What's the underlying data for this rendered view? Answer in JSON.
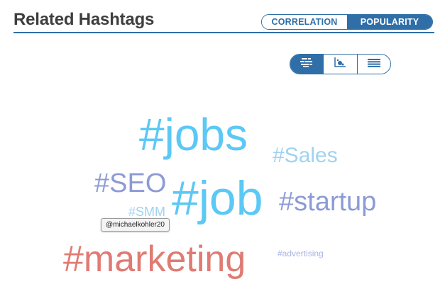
{
  "header": {
    "title": "Related Hashtags"
  },
  "mode_toggle": {
    "options": [
      "CORRELATION",
      "POPULARITY"
    ],
    "selected": "POPULARITY"
  },
  "view_switcher": {
    "options": [
      {
        "icon": "cloud-view-icon",
        "active": true
      },
      {
        "icon": "scatter-view-icon",
        "active": false
      },
      {
        "icon": "list-view-icon",
        "active": false
      }
    ]
  },
  "cloud": {
    "tags": [
      {
        "text": "#jobs",
        "color": "#5bc8f5"
      },
      {
        "text": "#Sales",
        "color": "#9fd3f0"
      },
      {
        "text": "#SEO",
        "color": "#8c9bd6"
      },
      {
        "text": "#job",
        "color": "#5bc8f5"
      },
      {
        "text": "#startup",
        "color": "#8c9bd6"
      },
      {
        "text": "#SMM",
        "color": "#9fd3f0"
      },
      {
        "text": "#marketing",
        "color": "#e07b73"
      },
      {
        "text": "#advertising",
        "color": "#aab3e0"
      }
    ]
  },
  "tooltip": {
    "text": "@michaelkohler20"
  },
  "colors": {
    "accent": "#2f6ea7",
    "title": "#3e3e3e"
  }
}
